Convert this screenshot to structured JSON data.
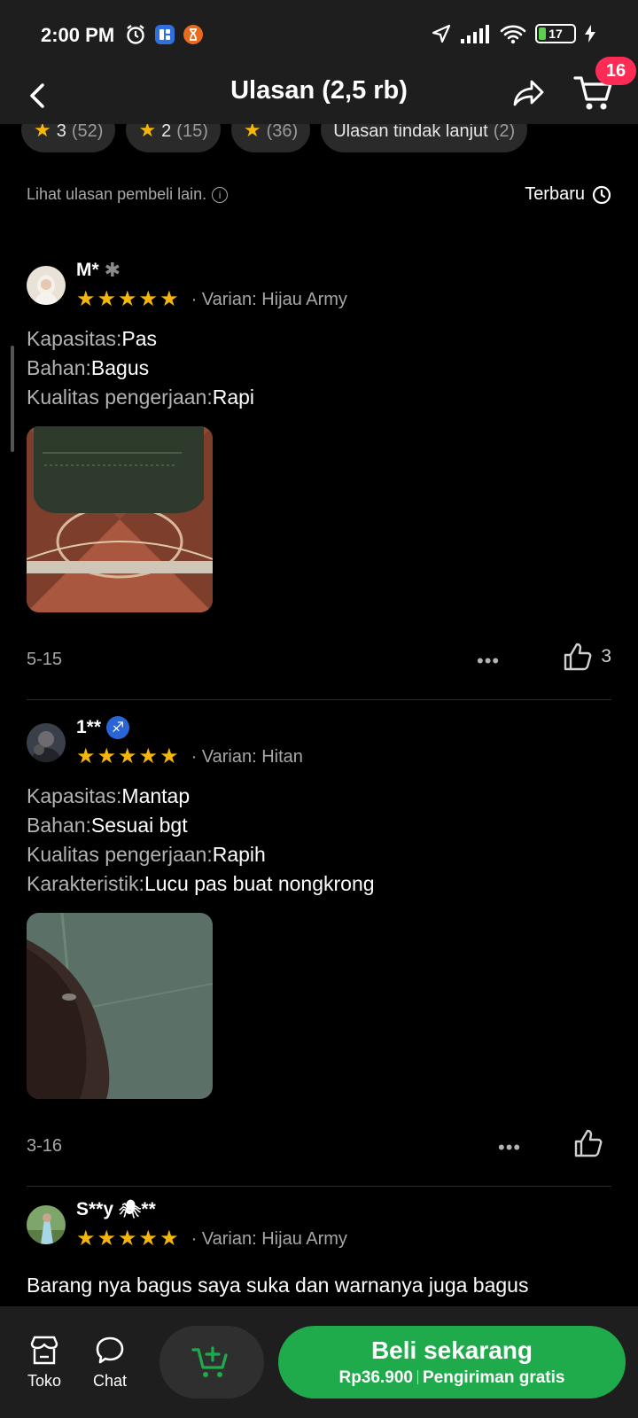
{
  "status_bar": {
    "time": "2:00 PM",
    "battery": "17",
    "icons": [
      "alarm-icon",
      "app-notification-icon",
      "hourglass-icon",
      "location-icon",
      "signal-icon",
      "wifi-icon",
      "battery-icon",
      "charging-icon"
    ]
  },
  "header": {
    "title": "Ulasan (2,5 rb)",
    "cart_badge": "16"
  },
  "filters": {
    "chips": [
      {
        "star": "★",
        "label": "3",
        "count": "(52)"
      },
      {
        "star": "★",
        "label": "2",
        "count": "(15)"
      },
      {
        "star": "★",
        "label": "",
        "count": "(36)"
      },
      {
        "star": "",
        "label": "Ulasan tindak lanjut",
        "count": "(2)"
      }
    ]
  },
  "info": {
    "text": "Lihat ulasan pembeli lain.",
    "info_icon": "i",
    "sort_label": "Terbaru"
  },
  "reviews": [
    {
      "name": "M*",
      "badge": "✱",
      "rating": 5,
      "variant": "Varian: Hijau Army",
      "lines": [
        {
          "label": "Kapasitas:",
          "value": "Pas"
        },
        {
          "label": "Bahan:",
          "value": "Bagus"
        },
        {
          "label": "Kualitas pengerjaan:",
          "value": "Rapi"
        }
      ],
      "date": "5-15",
      "more": "•••",
      "likes": "3"
    },
    {
      "name": "1**",
      "badge": "♐",
      "rating": 5,
      "variant": "Varian: Hitan",
      "lines": [
        {
          "label": "Kapasitas:",
          "value": "Mantap"
        },
        {
          "label": "Bahan:",
          "value": "Sesuai bgt"
        },
        {
          "label": "Kualitas pengerjaan:",
          "value": "Rapih"
        },
        {
          "label": "Karakteristik:",
          "value": "Lucu pas buat nongkrong"
        }
      ],
      "date": "3-16",
      "more": "•••",
      "likes": ""
    },
    {
      "name": "S**y",
      "badge": "🕷",
      "name_suffix": "**",
      "rating": 5,
      "variant": "Varian: Hijau Army",
      "text": "Barang nya bagus saya suka dan warnanya juga bagus"
    }
  ],
  "bottom_bar": {
    "shop_label": "Toko",
    "chat_label": "Chat",
    "buy_label": "Beli sekarang",
    "price": "Rp36.900",
    "shipping": "Pengiriman gratis"
  },
  "colors": {
    "accent_green": "#1fab4c",
    "star": "#f5b50a",
    "badge_red": "#fe2c55"
  }
}
